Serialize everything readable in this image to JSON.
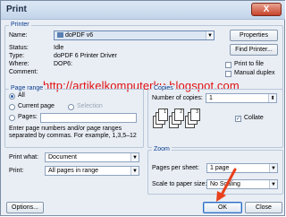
{
  "window": {
    "title": "Print",
    "close_label": "X"
  },
  "printer": {
    "group_label": "Printer",
    "name_label": "Name:",
    "name_value": "doPDF v6",
    "status_label": "Status:",
    "status_value": "Idle",
    "type_label": "Type:",
    "type_value": "doPDF 6 Printer Driver",
    "where_label": "Where:",
    "where_value": "DOP6:",
    "comment_label": "Comment:",
    "comment_value": "",
    "properties_label": "Properties",
    "find_printer_label": "Find Printer...",
    "print_to_file_label": "Print to file",
    "manual_duplex_label": "Manual duplex"
  },
  "watermark_url": "http://artikelkomputerku.blogspot.com",
  "page_range": {
    "group_label": "Page range",
    "all_label": "All",
    "current_label": "Current page",
    "selection_label": "Selection",
    "pages_label": "Pages:",
    "hint": "Enter page numbers and/or page ranges separated by commas. For example, 1,3,5–12"
  },
  "copies": {
    "group_label": "Copies",
    "number_label": "Number of copies:",
    "number_value": "1",
    "collate_label": "Collate",
    "collate_checked": true
  },
  "print_what": {
    "label": "Print what:",
    "value": "Document"
  },
  "print": {
    "label": "Print:",
    "value": "All pages in range"
  },
  "zoom": {
    "group_label": "Zoom",
    "pages_per_sheet_label": "Pages per sheet:",
    "pages_per_sheet_value": "1 page",
    "scale_label": "Scale to paper size:",
    "scale_value": "No Scaling"
  },
  "footer": {
    "options_label": "Options...",
    "ok_label": "OK",
    "close_label": "Close"
  },
  "colors": {
    "accent": "#0a3c8c",
    "watermark": "#e01010",
    "arrow": "#e8401c"
  }
}
